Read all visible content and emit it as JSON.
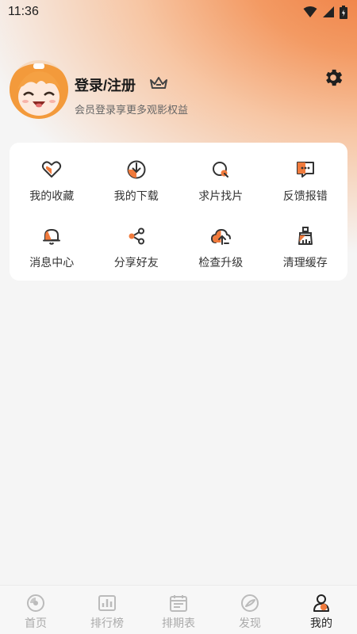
{
  "status_bar": {
    "time": "11:36"
  },
  "profile": {
    "title": "登录/注册",
    "subtitle": "会员登录享更多观影权益"
  },
  "menu": {
    "items": [
      {
        "label": "我的收藏",
        "icon": "heart-icon"
      },
      {
        "label": "我的下载",
        "icon": "download-icon"
      },
      {
        "label": "求片找片",
        "icon": "search-film-icon"
      },
      {
        "label": "反馈报错",
        "icon": "feedback-icon"
      },
      {
        "label": "消息中心",
        "icon": "bell-icon"
      },
      {
        "label": "分享好友",
        "icon": "share-icon"
      },
      {
        "label": "检查升级",
        "icon": "upgrade-icon"
      },
      {
        "label": "清理缓存",
        "icon": "clean-icon"
      }
    ]
  },
  "tabbar": {
    "tabs": [
      {
        "label": "首页",
        "icon": "home-icon"
      },
      {
        "label": "排行榜",
        "icon": "ranking-icon"
      },
      {
        "label": "排期表",
        "icon": "calendar-icon"
      },
      {
        "label": "发现",
        "icon": "discover-icon"
      },
      {
        "label": "我的",
        "icon": "mine-icon",
        "active": true
      }
    ]
  },
  "colors": {
    "accent": "#f07a3c",
    "icon_dark": "#333333"
  }
}
